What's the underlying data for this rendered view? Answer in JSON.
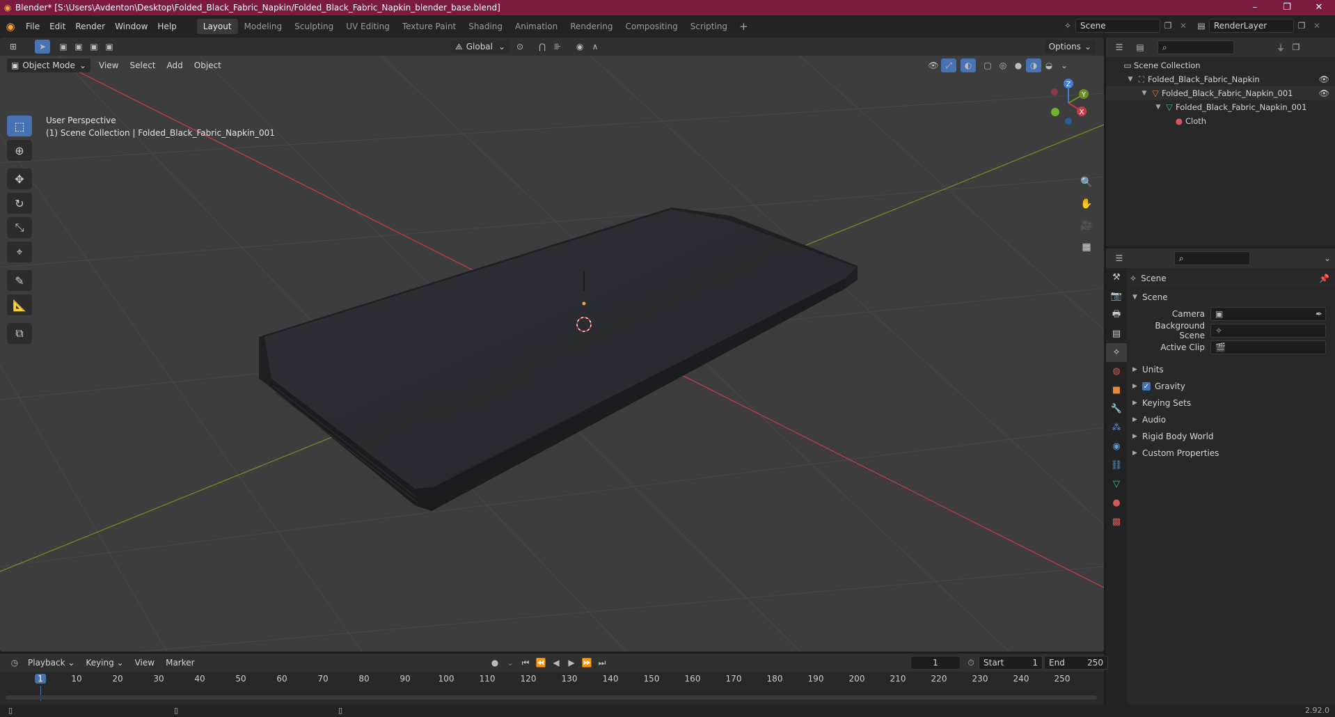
{
  "window": {
    "title": "Blender* [S:\\Users\\Avdenton\\Desktop\\Folded_Black_Fabric_Napkin/Folded_Black_Fabric_Napkin_blender_base.blend]",
    "controls": [
      "–",
      "❐",
      "✕"
    ]
  },
  "menubar": {
    "menus": [
      "File",
      "Edit",
      "Render",
      "Window",
      "Help"
    ],
    "workspaces": [
      "Layout",
      "Modeling",
      "Sculpting",
      "UV Editing",
      "Texture Paint",
      "Shading",
      "Animation",
      "Rendering",
      "Compositing",
      "Scripting"
    ],
    "active_workspace": "Layout",
    "add_workspace": "+",
    "scene_name": "Scene",
    "view_layer": "RenderLayer"
  },
  "viewport": {
    "transform_orientation": "Global",
    "options_label": "Options",
    "mode": "Object Mode",
    "menus": [
      "View",
      "Select",
      "Add",
      "Object"
    ],
    "info_line1": "User Perspective",
    "info_line2": "(1) Scene Collection | Folded_Black_Fabric_Napkin_001",
    "gizmo": {
      "z": "Z",
      "y": "Y",
      "x": "X"
    }
  },
  "outliner": {
    "rows": [
      {
        "label": "Scene Collection"
      },
      {
        "label": "Folded_Black_Fabric_Napkin"
      },
      {
        "label": "Folded_Black_Fabric_Napkin_001"
      },
      {
        "label": "Folded_Black_Fabric_Napkin_001"
      },
      {
        "label": "Cloth"
      }
    ]
  },
  "properties": {
    "context": "Scene",
    "section": "Scene",
    "fields": {
      "camera": "Camera",
      "background_scene": "Background Scene",
      "active_clip": "Active Clip"
    },
    "subsections": {
      "units": "Units",
      "gravity": "Gravity",
      "keying_sets": "Keying Sets",
      "audio": "Audio",
      "rigid_body_world": "Rigid Body World",
      "custom_properties": "Custom Properties"
    }
  },
  "timeline": {
    "menus": [
      "Playback",
      "Keying",
      "View",
      "Marker"
    ],
    "current_frame": "1",
    "start_label": "Start",
    "start_value": "1",
    "end_label": "End",
    "end_value": "250",
    "ticks": [
      "10",
      "20",
      "30",
      "40",
      "50",
      "60",
      "70",
      "80",
      "90",
      "100",
      "110",
      "120",
      "130",
      "140",
      "150",
      "160",
      "170",
      "180",
      "190",
      "200",
      "210",
      "220",
      "230",
      "240",
      "250"
    ]
  },
  "statusbar": {
    "version": "2.92.0"
  },
  "colors": {
    "titlebar": "#7d1a3f",
    "accent": "#4772b3",
    "axis_x": "#c43c46",
    "axis_y": "#6b8e23",
    "axis_z": "#3f7fd6"
  }
}
